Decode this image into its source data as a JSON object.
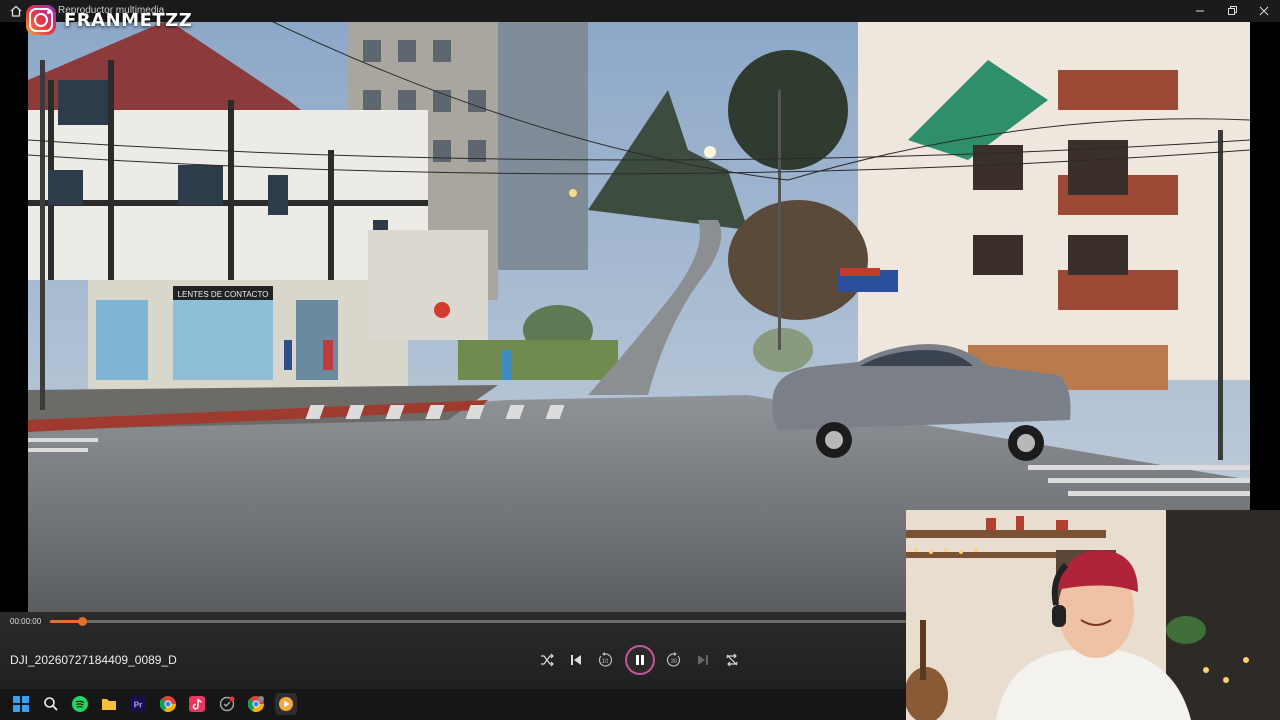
{
  "window": {
    "title": "Reproductor multimedia",
    "icons": [
      "home-icon",
      "minimize-icon",
      "restore-icon",
      "close-icon"
    ]
  },
  "watermark": {
    "handle": "FRANMETZZ",
    "icon": "instagram-icon"
  },
  "video": {
    "scene_signs": [
      "LENTES DE CONTACTO"
    ]
  },
  "player": {
    "current_time": "00:00:00",
    "progress": 0.037,
    "file_name": "DJI_20260727184409_0089_D",
    "accent": "#e5702a",
    "play_ring": "#c4579a",
    "buttons": {
      "shuffle": "shuffle-icon",
      "previous": "previous-icon",
      "rewind": "rewind-10-icon",
      "play_pause": "pause-icon",
      "forward": "forward-30-icon",
      "next": "next-icon",
      "repeat": "repeat-off-icon"
    },
    "rewind_label": "10",
    "forward_label": "30"
  },
  "taskbar": {
    "apps": [
      "windows-start-icon",
      "search-icon",
      "spotify-icon",
      "file-explorer-icon",
      "premiere-pro-icon",
      "chrome-icon",
      "tiktok-icon",
      "app-icon",
      "chrome-profile-icon",
      "media-player-icon"
    ]
  }
}
